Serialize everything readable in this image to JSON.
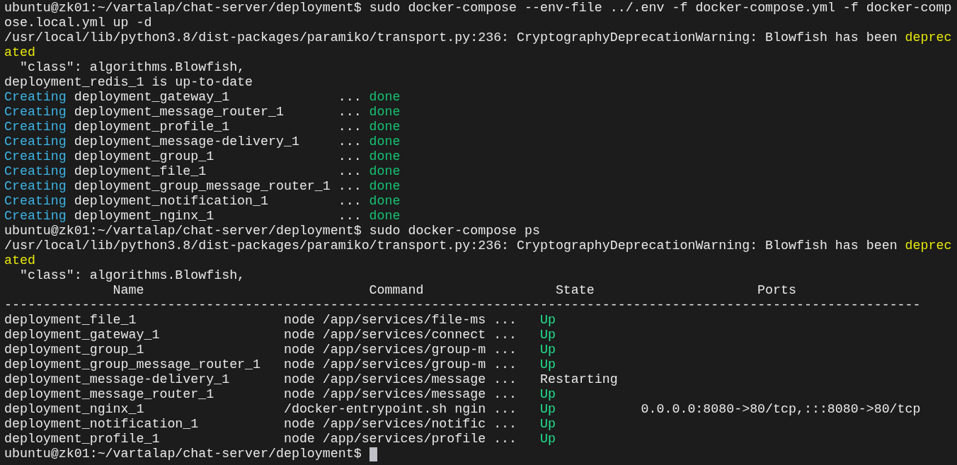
{
  "terminal": {
    "lines": [
      {
        "kind": "prompt",
        "prompt": "ubuntu@zk01:~/vartalap/chat-server/deployment$",
        "command": "sudo docker-compose --env-file ../.env -f docker-compose.yml -f docker-comp"
      },
      {
        "kind": "text",
        "segments": [
          {
            "text": "ose.local.yml up -d",
            "kind": "plain"
          }
        ]
      },
      {
        "kind": "text",
        "segments": [
          {
            "text": "/usr/local/lib/python3.8/dist-packages/paramiko/transport.py:236: CryptographyDeprecationWarning: Blowfish has been",
            "kind": "plain"
          },
          {
            "text": "deprec",
            "kind": "warning"
          }
        ]
      },
      {
        "kind": "text",
        "segments": [
          {
            "text": "ated",
            "kind": "warning"
          }
        ]
      },
      {
        "kind": "text",
        "segments": [
          {
            "text": "  \"class\": algorithms.Blowfish,",
            "kind": "plain"
          }
        ]
      },
      {
        "kind": "text",
        "segments": [
          {
            "text": "deployment_redis_1 is up-to-date",
            "kind": "plain"
          }
        ]
      },
      {
        "kind": "progress",
        "label": "Creating",
        "name": "deployment_gateway_1",
        "dots": "...",
        "status": "done"
      },
      {
        "kind": "progress",
        "label": "Creating",
        "name": "deployment_message_router_1",
        "dots": "...",
        "status": "done"
      },
      {
        "kind": "progress",
        "label": "Creating",
        "name": "deployment_profile_1",
        "dots": "...",
        "status": "done"
      },
      {
        "kind": "progress",
        "label": "Creating",
        "name": "deployment_message-delivery_1",
        "dots": "...",
        "status": "done"
      },
      {
        "kind": "progress",
        "label": "Creating",
        "name": "deployment_group_1",
        "dots": "...",
        "status": "done"
      },
      {
        "kind": "progress",
        "label": "Creating",
        "name": "deployment_file_1",
        "dots": "...",
        "status": "done"
      },
      {
        "kind": "progress",
        "label": "Creating",
        "name": "deployment_group_message_router_1",
        "dots": "...",
        "status": "done"
      },
      {
        "kind": "progress",
        "label": "Creating",
        "name": "deployment_notification_1",
        "dots": "...",
        "status": "done"
      },
      {
        "kind": "progress",
        "label": "Creating",
        "name": "deployment_nginx_1",
        "dots": "...",
        "status": "done"
      },
      {
        "kind": "prompt",
        "prompt": "ubuntu@zk01:~/vartalap/chat-server/deployment$",
        "command": "sudo docker-compose ps"
      },
      {
        "kind": "text",
        "segments": [
          {
            "text": "/usr/local/lib/python3.8/dist-packages/paramiko/transport.py:236: CryptographyDeprecationWarning: Blowfish has been",
            "kind": "plain"
          },
          {
            "text": "deprec",
            "kind": "warning"
          }
        ]
      },
      {
        "kind": "text",
        "segments": [
          {
            "text": "ated",
            "kind": "warning"
          }
        ]
      },
      {
        "kind": "text",
        "segments": [
          {
            "text": "  \"class\": algorithms.Blowfish,",
            "kind": "plain"
          }
        ]
      },
      {
        "kind": "header",
        "cells": [
          "Name",
          "Command",
          "State",
          "Ports"
        ]
      },
      {
        "kind": "rule",
        "text": "----------------------------------------------------------------------------------------------------------------------"
      },
      {
        "kind": "row",
        "name": "deployment_file_1",
        "command": "node /app/services/file-ms ...",
        "state": {
          "text": "Up",
          "kind": "up"
        }
      },
      {
        "kind": "row",
        "name": "deployment_gateway_1",
        "command": "node /app/services/connect ...",
        "state": {
          "text": "Up",
          "kind": "up"
        }
      },
      {
        "kind": "row",
        "name": "deployment_group_1",
        "command": "node /app/services/group-m ...",
        "state": {
          "text": "Up",
          "kind": "up"
        }
      },
      {
        "kind": "row",
        "name": "deployment_group_message_router_1",
        "command": "node /app/services/group-m ...",
        "state": {
          "text": "Up",
          "kind": "up"
        }
      },
      {
        "kind": "row",
        "name": "deployment_message-delivery_1",
        "command": "node /app/services/message ...",
        "state": {
          "text": "Restarting",
          "kind": "restarting"
        }
      },
      {
        "kind": "row",
        "name": "deployment_message_router_1",
        "command": "node /app/services/message ...",
        "state": {
          "text": "Up",
          "kind": "up"
        }
      },
      {
        "kind": "row",
        "name": "deployment_nginx_1",
        "command": "/docker-entrypoint.sh ngin ...",
        "state": {
          "text": "Up",
          "kind": "up"
        },
        "ports": "0.0.0.0:8080->80/tcp,:::8080->80/tcp"
      },
      {
        "kind": "row",
        "name": "deployment_notification_1",
        "command": "node /app/services/notific ...",
        "state": {
          "text": "Up",
          "kind": "up"
        }
      },
      {
        "kind": "row",
        "name": "deployment_profile_1",
        "command": "node /app/services/profile ...",
        "state": {
          "text": "Up",
          "kind": "up"
        }
      },
      {
        "kind": "prompt",
        "prompt": "ubuntu@zk01:~/vartalap/chat-server/deployment$",
        "cursor": true
      }
    ]
  }
}
